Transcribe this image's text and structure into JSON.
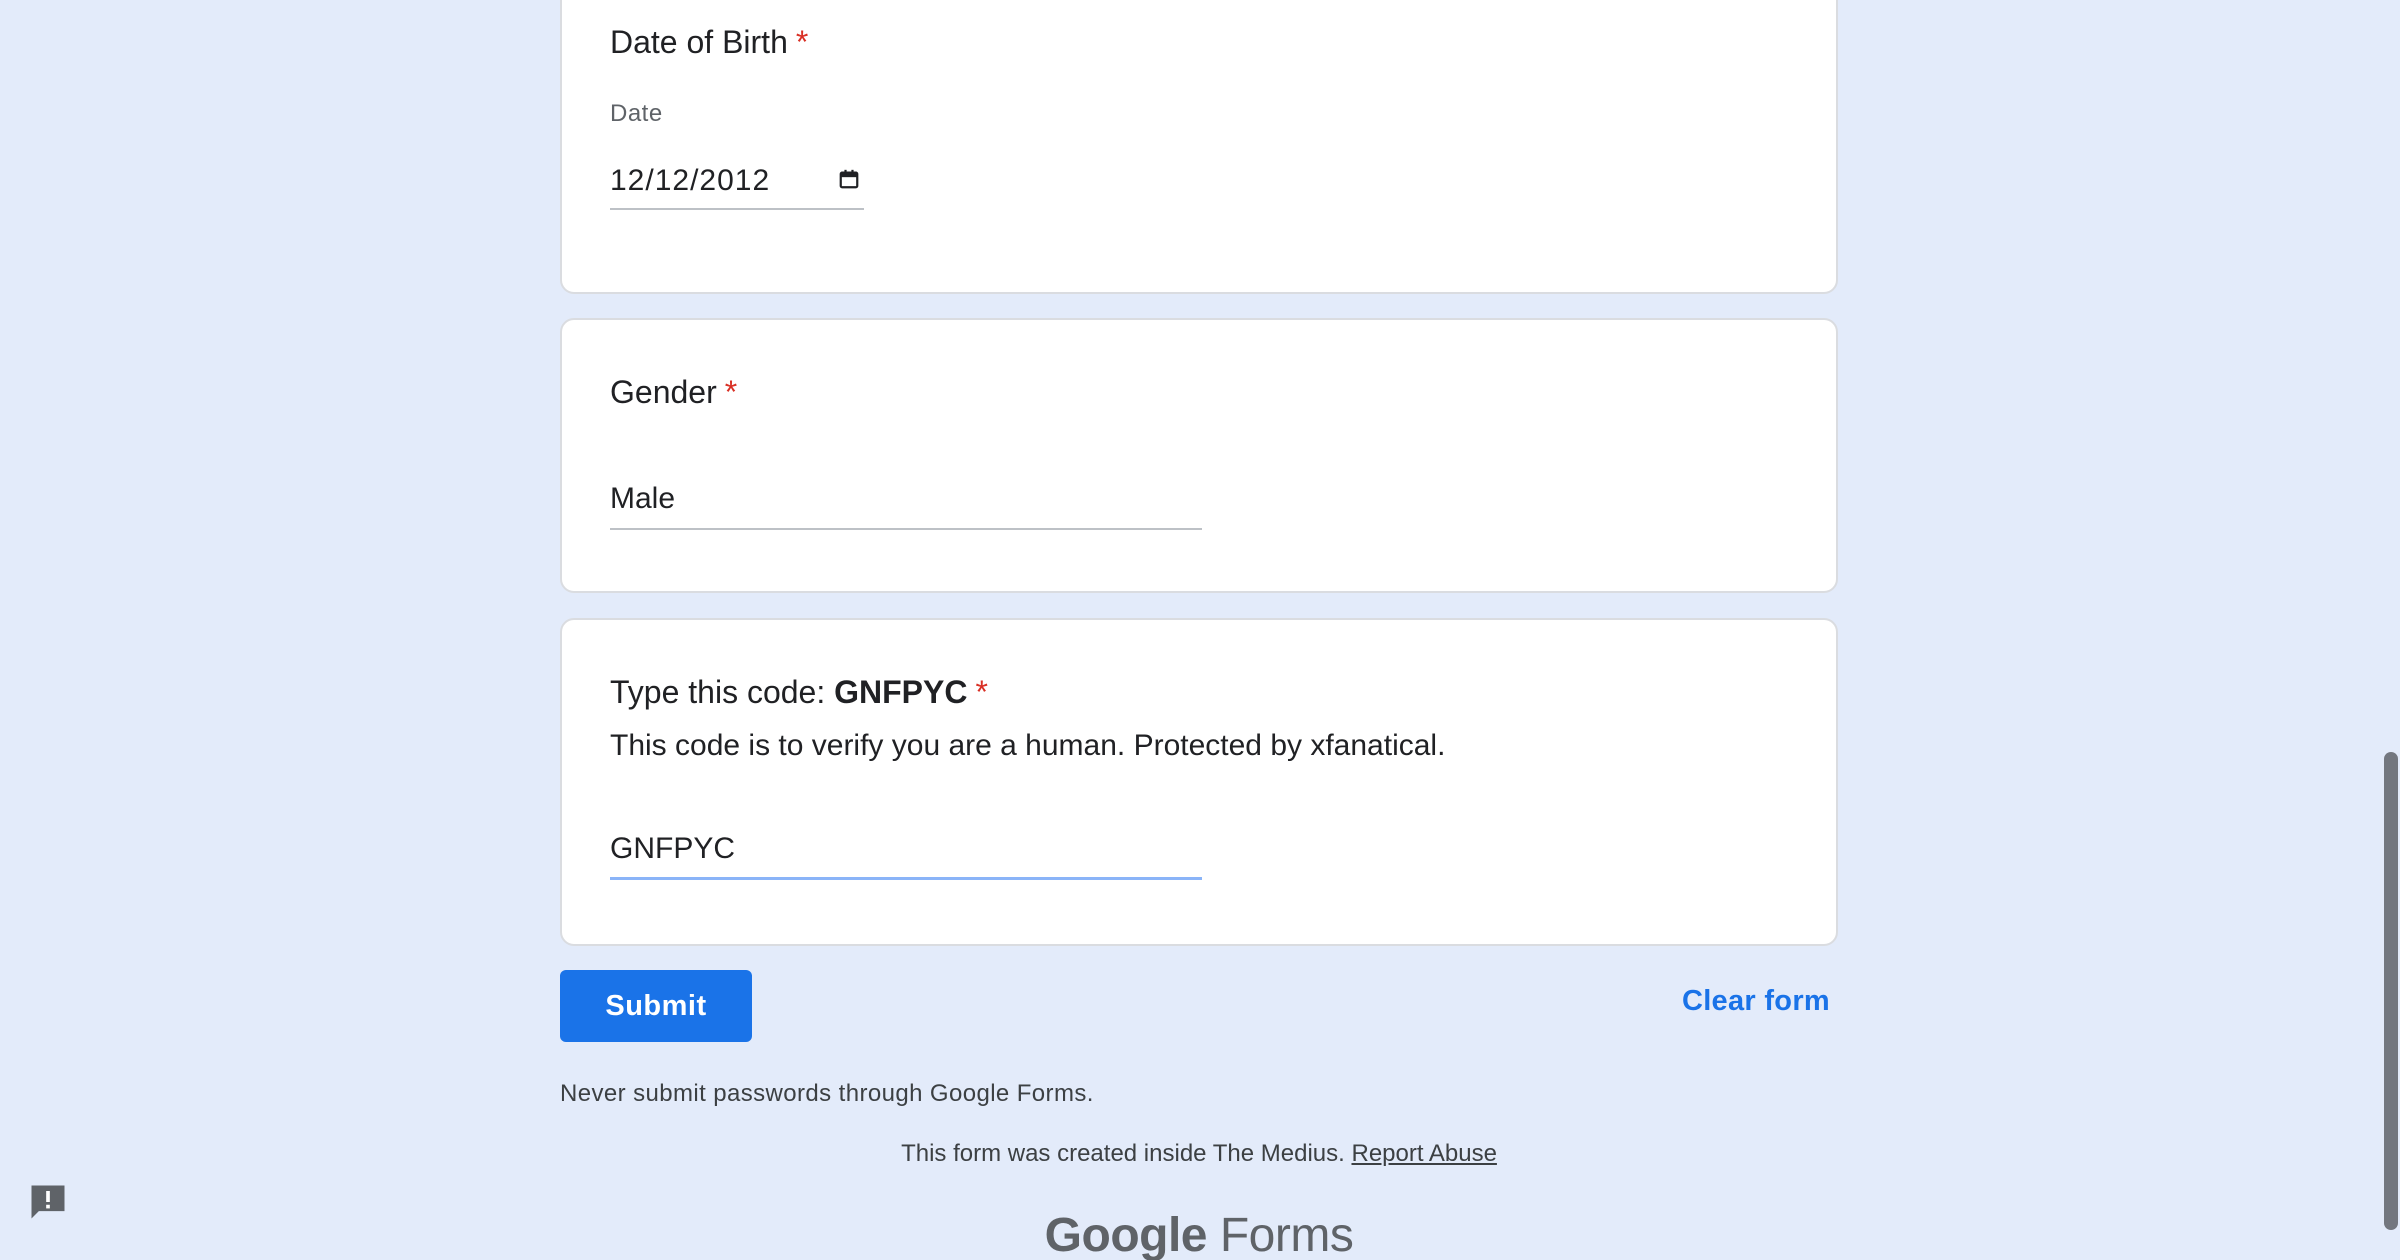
{
  "dob": {
    "title": "Date of Birth",
    "required_mark": "*",
    "sub_label": "Date",
    "value": "12/12/2012",
    "icon": "calendar-icon"
  },
  "gender": {
    "title": "Gender",
    "required_mark": "*",
    "value": "Male"
  },
  "code": {
    "title_prefix": "Type this code: ",
    "code_text": "GNFPYC",
    "required_mark": "*",
    "description": "This code is to verify you are a human. Protected by xfanatical.",
    "value": "GNFPYC"
  },
  "actions": {
    "submit_label": "Submit",
    "clear_label": "Clear form"
  },
  "footer": {
    "disclaimer": "Never submit passwords through Google Forms.",
    "created_text": "This form was created inside The Medius. ",
    "report_link": "Report Abuse",
    "brand_google": "Google",
    "brand_forms": " Forms"
  },
  "icons": {
    "feedback": "report-issue-icon"
  },
  "colors": {
    "page_background": "#e3ebfa",
    "primary": "#1a73e8",
    "required": "#d93025",
    "focus_underline": "#8ab4f8"
  }
}
